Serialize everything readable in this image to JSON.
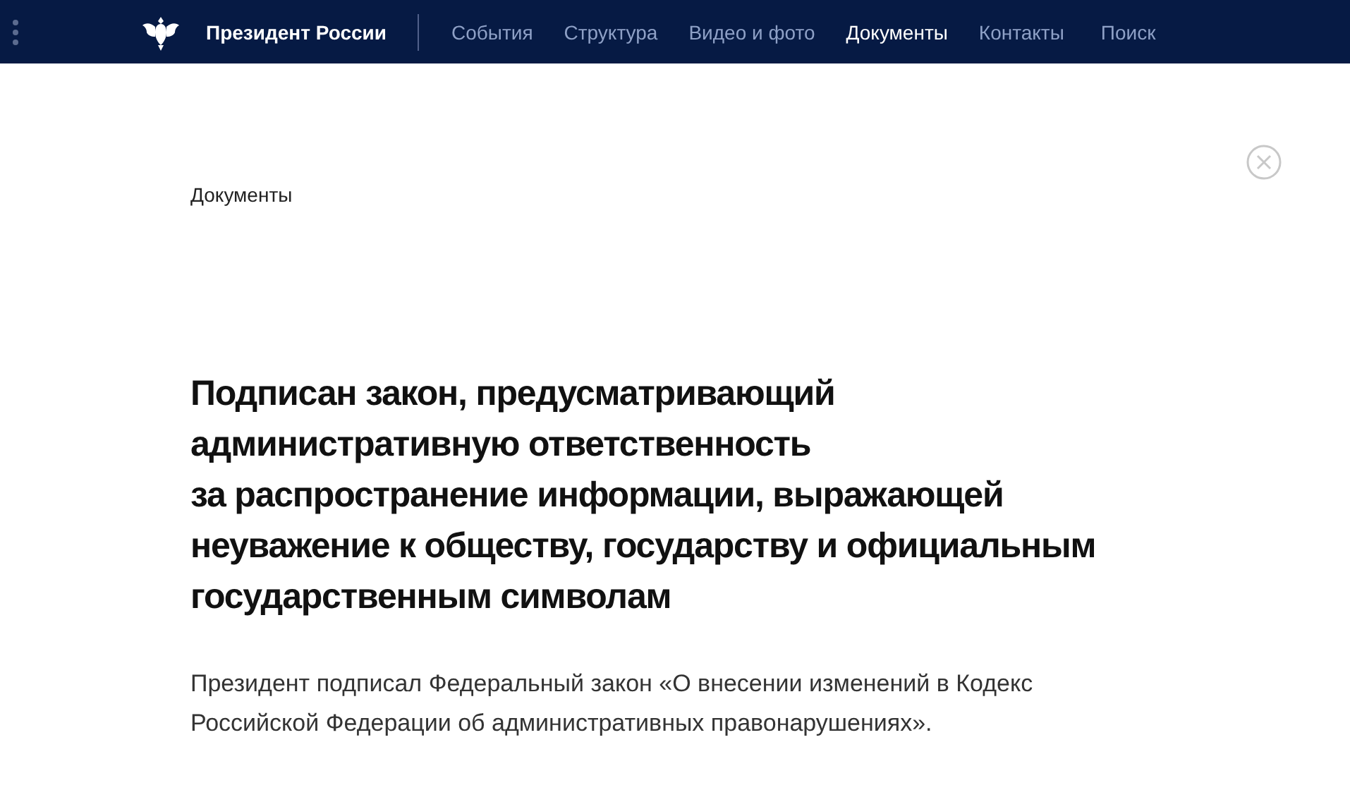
{
  "header": {
    "site_title": "Президент России",
    "nav": [
      {
        "label": "События",
        "selected": false
      },
      {
        "label": "Структура",
        "selected": false
      },
      {
        "label": "Видео и фото",
        "selected": false
      },
      {
        "label": "Документы",
        "selected": true
      },
      {
        "label": "Контакты",
        "selected": false
      },
      {
        "label": "Поиск",
        "selected": false
      }
    ]
  },
  "breadcrumb": "Документы",
  "title": "Подписан закон, предусматривающий\nадминистративную ответственность\nза распространение информации, выражающей\nнеуважение к обществу, государству и официальным\nгосударственным символам",
  "lead": "Президент подписал Федеральный закон «О внесении изменений в Кодекс Российской Федерации об административных правонарушениях»."
}
